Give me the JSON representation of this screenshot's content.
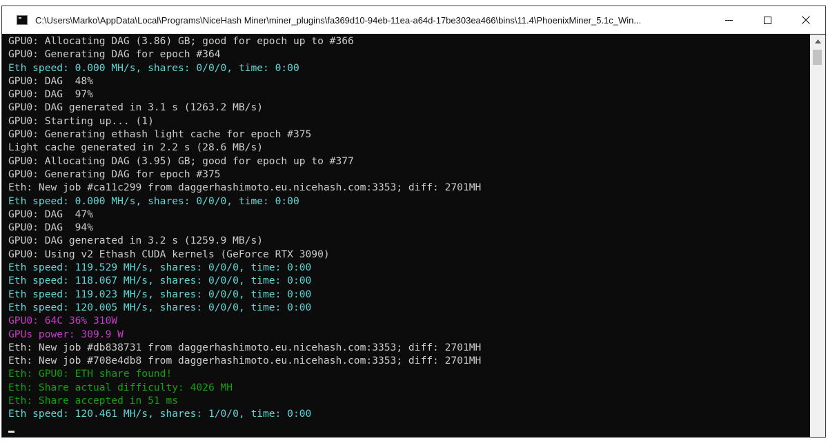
{
  "window": {
    "title": "C:\\Users\\Marko\\AppData\\Local\\Programs\\NiceHash Miner\\miner_plugins\\fa369d10-94eb-11ea-a64d-17be303ea466\\bins\\11.4\\PhoenixMiner_5.1c_Win...",
    "minimize_label": "—",
    "maximize_label": "☐",
    "close_label": "✕"
  },
  "colors": {
    "white": "#cccccc",
    "cyan": "#3a96dd",
    "teal": "#61d6d6",
    "magenta": "#c53ec5",
    "green": "#13a10e"
  },
  "console": {
    "lines": [
      {
        "text": "GPU0: Allocating DAG (3.86) GB; good for epoch up to #366",
        "color": "white"
      },
      {
        "text": "GPU0: Generating DAG for epoch #364",
        "color": "white"
      },
      {
        "text": "Eth speed: 0.000 MH/s, shares: 0/0/0, time: 0:00",
        "color": "teal"
      },
      {
        "text": "GPU0: DAG  48%",
        "color": "white"
      },
      {
        "text": "GPU0: DAG  97%",
        "color": "white"
      },
      {
        "text": "GPU0: DAG generated in 3.1 s (1263.2 MB/s)",
        "color": "white"
      },
      {
        "text": "GPU0: Starting up... (1)",
        "color": "white"
      },
      {
        "text": "GPU0: Generating ethash light cache for epoch #375",
        "color": "white"
      },
      {
        "text": "Light cache generated in 2.2 s (28.6 MB/s)",
        "color": "white"
      },
      {
        "text": "GPU0: Allocating DAG (3.95) GB; good for epoch up to #377",
        "color": "white"
      },
      {
        "text": "GPU0: Generating DAG for epoch #375",
        "color": "white"
      },
      {
        "text": "Eth: New job #ca11c299 from daggerhashimoto.eu.nicehash.com:3353; diff: 2701MH",
        "color": "white"
      },
      {
        "text": "Eth speed: 0.000 MH/s, shares: 0/0/0, time: 0:00",
        "color": "teal"
      },
      {
        "text": "GPU0: DAG  47%",
        "color": "white"
      },
      {
        "text": "GPU0: DAG  94%",
        "color": "white"
      },
      {
        "text": "GPU0: DAG generated in 3.2 s (1259.9 MB/s)",
        "color": "white"
      },
      {
        "text": "GPU0: Using v2 Ethash CUDA kernels (GeForce RTX 3090)",
        "color": "white"
      },
      {
        "text": "Eth speed: 119.529 MH/s, shares: 0/0/0, time: 0:00",
        "color": "teal"
      },
      {
        "text": "Eth speed: 118.067 MH/s, shares: 0/0/0, time: 0:00",
        "color": "teal"
      },
      {
        "text": "Eth speed: 119.023 MH/s, shares: 0/0/0, time: 0:00",
        "color": "teal"
      },
      {
        "text": "Eth speed: 120.005 MH/s, shares: 0/0/0, time: 0:00",
        "color": "teal"
      },
      {
        "text": "GPU0: 64C 36% 310W",
        "color": "magenta"
      },
      {
        "text": "GPUs power: 309.9 W",
        "color": "magenta"
      },
      {
        "text": "Eth: New job #db838731 from daggerhashimoto.eu.nicehash.com:3353; diff: 2701MH",
        "color": "white"
      },
      {
        "text": "Eth: New job #708e4db8 from daggerhashimoto.eu.nicehash.com:3353; diff: 2701MH",
        "color": "white"
      },
      {
        "text": "Eth: GPU0: ETH share found!",
        "color": "green"
      },
      {
        "text": "Eth: Share actual difficulty: 4026 MH",
        "color": "green"
      },
      {
        "text": "Eth: Share accepted in 51 ms",
        "color": "green"
      },
      {
        "text": "Eth speed: 120.461 MH/s, shares: 1/0/0, time: 0:00",
        "color": "teal"
      }
    ]
  }
}
